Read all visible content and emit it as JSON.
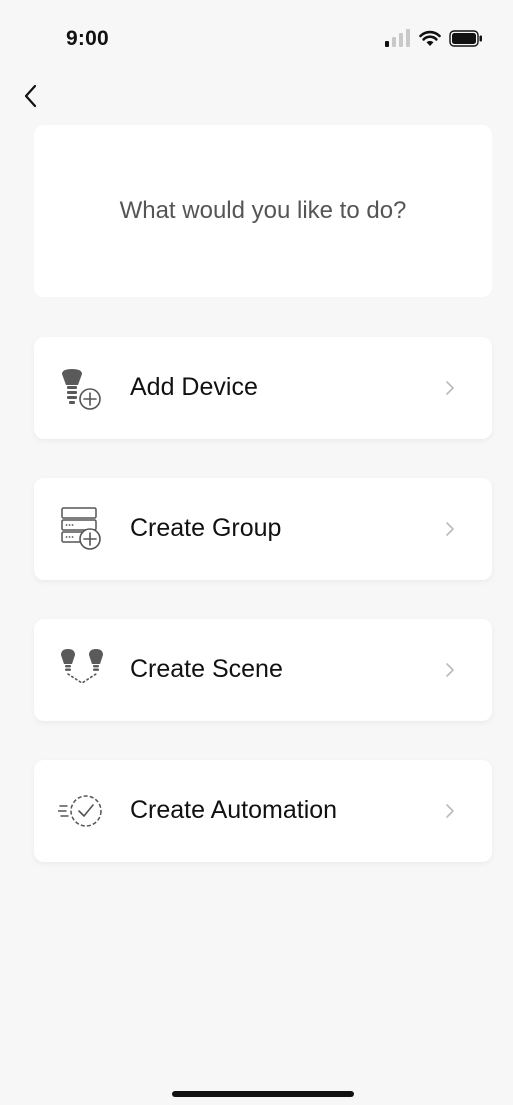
{
  "status_bar": {
    "time": "9:00"
  },
  "prompt": {
    "text": "What would you like to do?"
  },
  "actions": [
    {
      "label": "Add Device",
      "icon": "bulb-plus-icon"
    },
    {
      "label": "Create Group",
      "icon": "group-list-plus-icon"
    },
    {
      "label": "Create Scene",
      "icon": "two-bulbs-icon"
    },
    {
      "label": "Create Automation",
      "icon": "clock-check-icon"
    }
  ],
  "colors": {
    "background": "#f7f7f7",
    "card": "#ffffff",
    "icon_gray": "#555555",
    "chevron": "#bbbbbb"
  }
}
